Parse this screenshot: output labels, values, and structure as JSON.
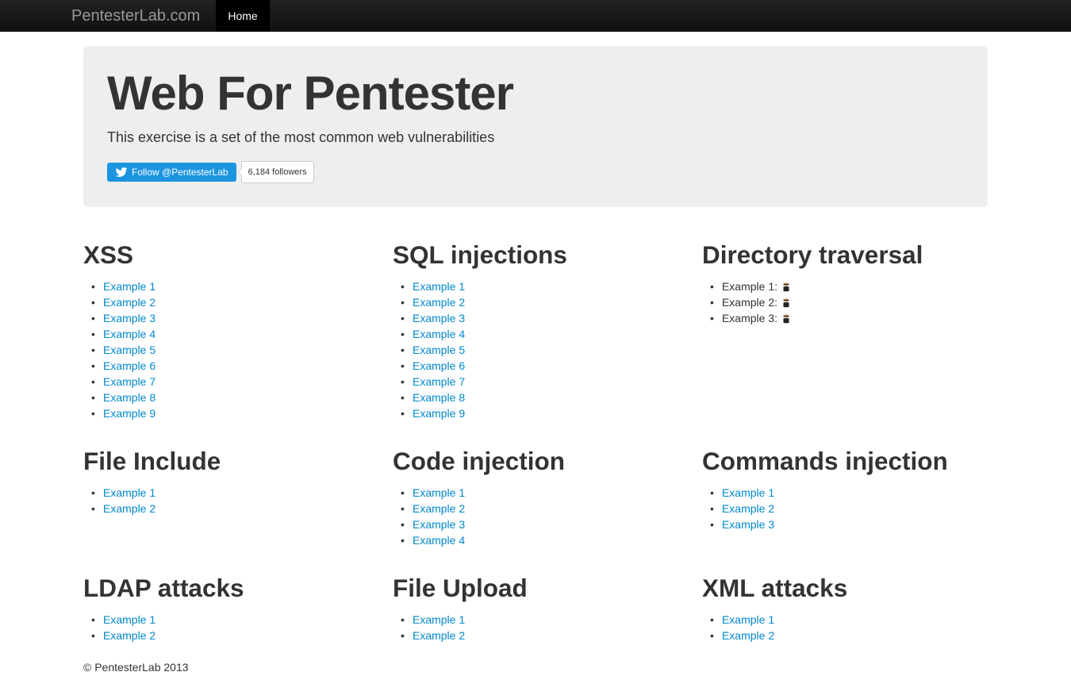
{
  "navbar": {
    "brand": "PentesterLab.com",
    "home": "Home"
  },
  "hero": {
    "title": "Web For Pentester",
    "subtitle": "This exercise is a set of the most common web vulnerabilities",
    "twitter_follow": "Follow @PentesterLab",
    "follower_count": "6,184 followers"
  },
  "sections": {
    "xss": {
      "title": "XSS",
      "items": [
        "Example 1",
        "Example 2",
        "Example 3",
        "Example 4",
        "Example 5",
        "Example 6",
        "Example 7",
        "Example 8",
        "Example 9"
      ]
    },
    "sqli": {
      "title": "SQL injections",
      "items": [
        "Example 1",
        "Example 2",
        "Example 3",
        "Example 4",
        "Example 5",
        "Example 6",
        "Example 7",
        "Example 8",
        "Example 9"
      ]
    },
    "dirtrav": {
      "title": "Directory traversal",
      "items": [
        "Example 1: ",
        "Example 2: ",
        "Example 3: "
      ]
    },
    "fileincl": {
      "title": "File Include",
      "items": [
        "Example 1",
        "Example 2"
      ]
    },
    "codeinj": {
      "title": "Code injection",
      "items": [
        "Example 1",
        "Example 2",
        "Example 3",
        "Example 4"
      ]
    },
    "cmdinj": {
      "title": "Commands injection",
      "items": [
        "Example 1",
        "Example 2",
        "Example 3"
      ]
    },
    "ldap": {
      "title": "LDAP attacks",
      "items": [
        "Example 1",
        "Example 2"
      ]
    },
    "fileupload": {
      "title": "File Upload",
      "items": [
        "Example 1",
        "Example 2"
      ]
    },
    "xml": {
      "title": "XML attacks",
      "items": [
        "Example 1",
        "Example 2"
      ]
    }
  },
  "footer": "© PentesterLab 2013"
}
